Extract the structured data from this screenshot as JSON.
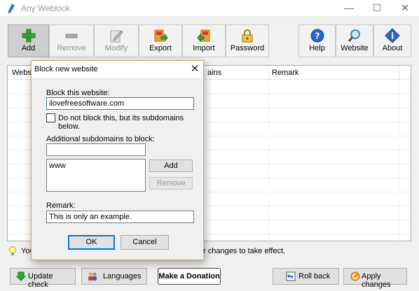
{
  "window": {
    "title": "Any Weblock",
    "minimize_glyph": "—",
    "maximize_glyph": "☐",
    "close_glyph": "✕"
  },
  "toolbar": {
    "add": "Add",
    "remove": "Remove",
    "modify": "Modify",
    "export": "Export",
    "import": "Import",
    "password": "Password",
    "help": "Help",
    "website": "Website",
    "about": "About"
  },
  "list": {
    "columns": [
      "Website",
      "Subdomains",
      "Remark"
    ],
    "visible_columns": [
      "Websit",
      "ains",
      "Remark"
    ]
  },
  "hint": {
    "part1": "You",
    "part2": "r changes to take effect."
  },
  "bottom": {
    "update_check": "Update check",
    "languages": "Languages",
    "donate": "Make a Donation",
    "roll_back": "Roll back",
    "apply_changes": "Apply changes"
  },
  "dialog": {
    "title": "Block new website",
    "close_glyph": "✕",
    "site_label": "Block this website:",
    "site_value": "ilovefreesoftware.com",
    "subdomain_only_label": "Do not block this, but its subdomains below.",
    "subdomain_only_checked": false,
    "additional_label": "Additional subdomains to block:",
    "additional_value": "",
    "subdomains": [
      "www"
    ],
    "add_button": "Add",
    "remove_button": "Remove",
    "remark_label": "Remark:",
    "remark_value": "This is only an example.",
    "ok": "OK",
    "cancel": "Cancel"
  },
  "colors": {
    "dialog_border": "#e0a355",
    "focus_border": "#0078d7"
  }
}
